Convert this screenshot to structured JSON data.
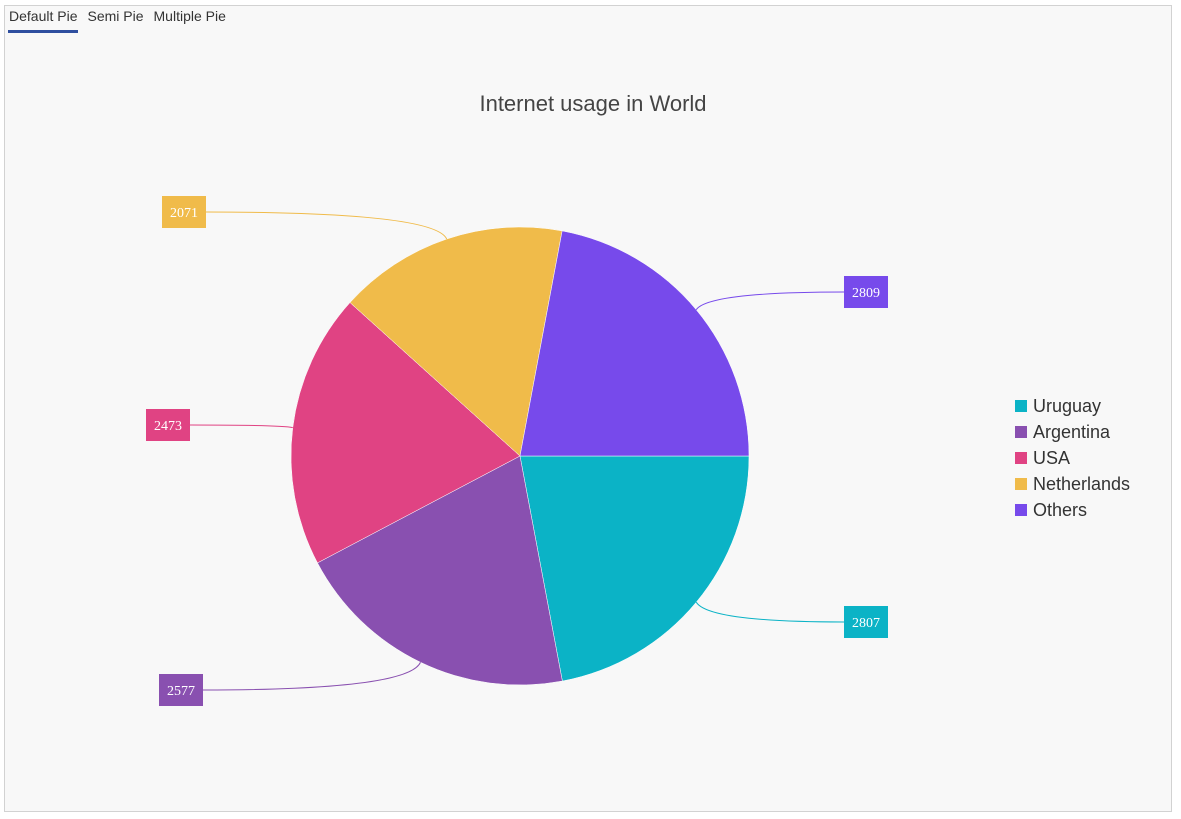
{
  "tabs": [
    {
      "label": "Default Pie",
      "active": true
    },
    {
      "label": "Semi Pie",
      "active": false
    },
    {
      "label": "Multiple Pie",
      "active": false
    }
  ],
  "chart_data": {
    "type": "pie",
    "title": "Internet usage in World",
    "categories": [
      "Uruguay",
      "Argentina",
      "USA",
      "Netherlands",
      "Others"
    ],
    "values": [
      2807,
      2577,
      2473,
      2071,
      2809
    ],
    "colors": [
      "#0bb3c6",
      "#8950b0",
      "#e04383",
      "#f0bb4a",
      "#774aeb"
    ],
    "legend_position": "right",
    "start_angle_deg": 0,
    "direction": "clockwise",
    "data_labels": "outside-with-connector"
  }
}
